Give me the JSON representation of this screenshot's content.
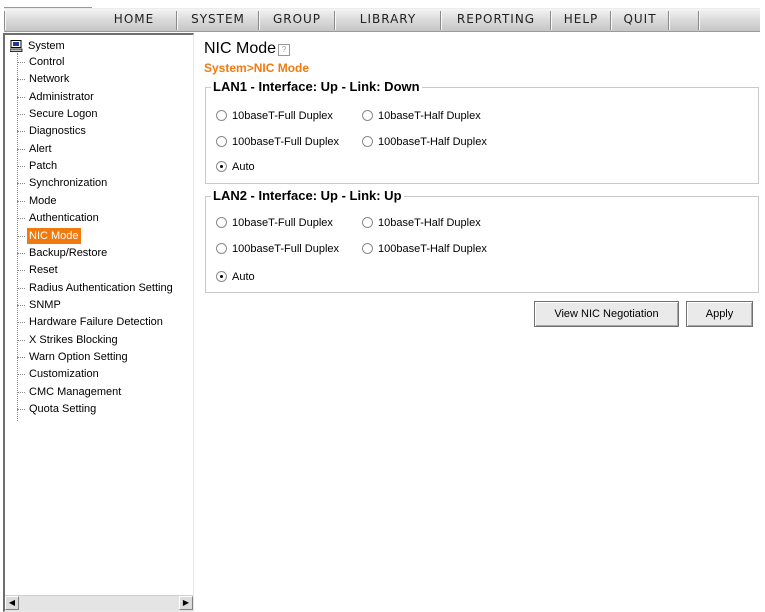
{
  "menu": [
    "HOME",
    "SYSTEM",
    "GROUP",
    "LIBRARY",
    "REPORTING",
    "HELP",
    "QUIT"
  ],
  "tree": {
    "root": "System",
    "items": [
      "Control",
      "Network",
      "Administrator",
      "Secure Logon",
      "Diagnostics",
      "Alert",
      "Patch",
      "Synchronization",
      "Mode",
      "Authentication",
      "NIC Mode",
      "Backup/Restore",
      "Reset",
      "Radius Authentication Setting",
      "SNMP",
      "Hardware Failure Detection",
      "X Strikes Blocking",
      "Warn Option Setting",
      "Customization",
      "CMC Management",
      "Quota Setting"
    ],
    "selected": "NIC Mode"
  },
  "page": {
    "title": "NIC Mode",
    "help_icon": "help-icon",
    "breadcrumb": "System>NIC Mode"
  },
  "lan1": {
    "legend": "LAN1 - Interface: Up - Link: Down",
    "options": [
      "10baseT-Full Duplex",
      "10baseT-Half Duplex",
      "100baseT-Full Duplex",
      "100baseT-Half Duplex",
      "Auto"
    ],
    "selected": "Auto"
  },
  "lan2": {
    "legend": "LAN2 - Interface: Up - Link: Up",
    "options": [
      "10baseT-Full Duplex",
      "10baseT-Half Duplex",
      "100baseT-Full Duplex",
      "100baseT-Half Duplex",
      "Auto"
    ],
    "selected": "Auto"
  },
  "buttons": {
    "view_nic": "View NIC Negotiation",
    "apply": "Apply"
  },
  "colors": {
    "accent": "#f07a0d"
  }
}
